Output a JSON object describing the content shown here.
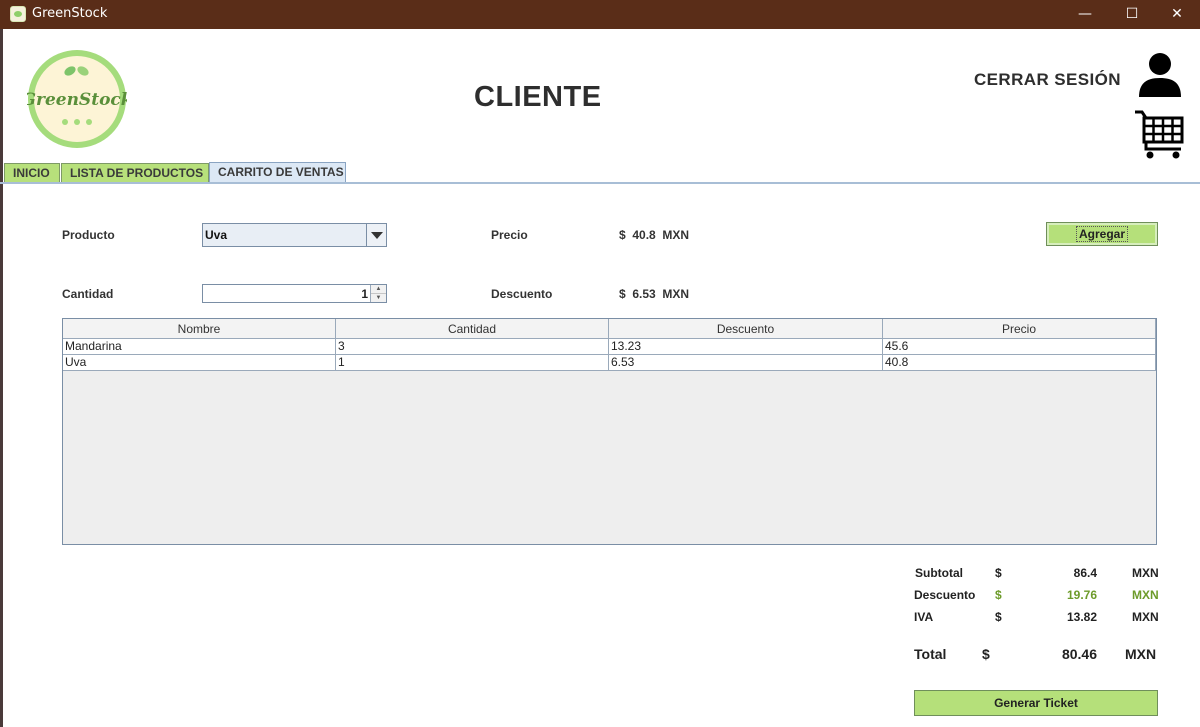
{
  "window": {
    "title": "GreenStock",
    "minimize": "—",
    "maximize": "☐",
    "close": "✕"
  },
  "header": {
    "logo_text": "GreenStock",
    "page_title": "CLIENTE",
    "logout_label": "CERRAR SESIÓN"
  },
  "tabs": [
    {
      "label": "INICIO",
      "active": false
    },
    {
      "label": "LISTA DE PRODUCTOS",
      "active": false
    },
    {
      "label": "CARRITO DE VENTAS",
      "active": true
    }
  ],
  "form": {
    "product_label": "Producto",
    "product_value": "Uva",
    "quantity_label": "Cantidad",
    "quantity_value": "1",
    "price_label": "Precio",
    "price_value": "$  40.8  MXN",
    "discount_label": "Descuento",
    "discount_value": "$  6.53  MXN",
    "add_button": "Agregar"
  },
  "table": {
    "columns": [
      "Nombre",
      "Cantidad",
      "Descuento",
      "Precio"
    ],
    "rows": [
      [
        "Mandarina",
        "3",
        "13.23",
        "45.6"
      ],
      [
        "Uva",
        "1",
        "6.53",
        "40.8"
      ]
    ]
  },
  "summary": {
    "subtotal": {
      "label": "Subtotal",
      "currency": "$",
      "value": "86.4",
      "unit": "MXN"
    },
    "discount": {
      "label": "Descuento",
      "currency": "$",
      "value": "19.76",
      "unit": "MXN"
    },
    "tax": {
      "label": "IVA",
      "currency": "$",
      "value": "13.82",
      "unit": "MXN"
    },
    "total": {
      "label": "Total",
      "currency": "$",
      "value": "80.46",
      "unit": "MXN"
    }
  },
  "ticket_button": "Generar Ticket",
  "colors": {
    "titlebar": "#5a2d18",
    "accent_green": "#b5e07a",
    "discount_text": "#6d9b2a"
  }
}
